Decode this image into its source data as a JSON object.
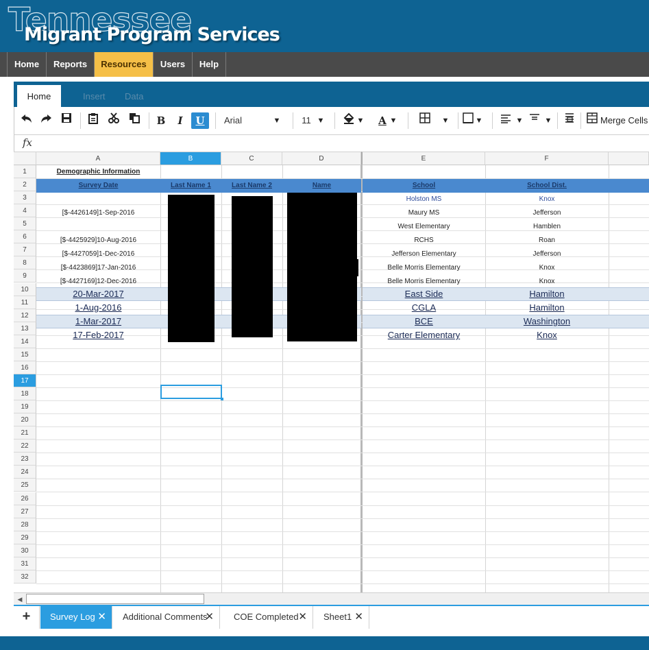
{
  "brand": {
    "state": "Tennessee",
    "title": "Migrant Program Services"
  },
  "nav": {
    "items": [
      {
        "label": "Home"
      },
      {
        "label": "Reports"
      },
      {
        "label": "Resources"
      },
      {
        "label": "Users"
      },
      {
        "label": "Help"
      }
    ],
    "active": "Resources"
  },
  "ribbon": {
    "tabs": [
      {
        "label": "Home"
      },
      {
        "label": "Insert"
      },
      {
        "label": "Data"
      }
    ],
    "active": "Home"
  },
  "toolbar": {
    "bold": "B",
    "italic": "I",
    "underline": "U",
    "font_name": "Arial",
    "font_size": "11",
    "font_color_letter": "A",
    "merge_cells": "Merge Cells"
  },
  "formula_bar": {
    "fx": "fx",
    "value": ""
  },
  "grid": {
    "columns": [
      "A",
      "B",
      "C",
      "D",
      "E",
      "F"
    ],
    "selected_column": "B",
    "selected_row": 17,
    "rows": [
      "1",
      "2",
      "3",
      "4",
      "5",
      "6",
      "7",
      "8",
      "9",
      "10",
      "11",
      "12",
      "13",
      "14",
      "15",
      "16",
      "17",
      "18",
      "19",
      "20",
      "21",
      "22",
      "23",
      "24",
      "25",
      "26",
      "27",
      "28",
      "29",
      "30",
      "31",
      "32"
    ],
    "title_cell": "Demographic Information",
    "headers": {
      "survey_date": "Survey Date",
      "last_name_1": "Last Name 1",
      "last_name_2": "Last Name 2",
      "name": "Name",
      "school": "School",
      "school_dist": "School Dist."
    },
    "data_rows": [
      {
        "date": "",
        "school": "Holston MS",
        "dist": "Knox"
      },
      {
        "date": "[$-4426149]1-Sep-2016",
        "school": "Maury MS",
        "dist": "Jefferson"
      },
      {
        "date": "",
        "school": "West Elementary",
        "dist": "Hamblen"
      },
      {
        "date": "[$-4425929]10-Aug-2016",
        "school": "RCHS",
        "dist": "Roan"
      },
      {
        "date": "[$-4427059]1-Dec-2016",
        "school": "Jefferson Elementary",
        "dist": "Jefferson"
      },
      {
        "date": "[$-4423869]17-Jan-2016",
        "school": "Belle Morris Elementary",
        "dist": "Knox"
      },
      {
        "date": "[$-4427169]12-Dec-2016",
        "school": "Belle Morris Elementary",
        "dist": "Knox"
      },
      {
        "date": "20-Mar-2017",
        "school": "East Side",
        "dist": "Hamilton"
      },
      {
        "date": "1-Aug-2016",
        "school": "CGLA",
        "dist": "Hamilton"
      },
      {
        "date": "1-Mar-2017",
        "school": "BCE",
        "dist": "Washington"
      },
      {
        "date": "17-Feb-2017",
        "school": "Carter Elementary",
        "dist": "Knox"
      }
    ]
  },
  "sheet_tabs": {
    "add": "+",
    "tabs": [
      {
        "label": "Survey Log"
      },
      {
        "label": "Additional Comments"
      },
      {
        "label": "COE Completed"
      },
      {
        "label": "Sheet1"
      }
    ],
    "active": "Survey Log",
    "close": "✕"
  },
  "colors": {
    "brand_blue": "#0e6393",
    "nav_dark": "#4a4a4a",
    "nav_active": "#f5bf47",
    "accent": "#2b9de0",
    "header_row": "#4a89cf",
    "band_row": "#dce6f1"
  }
}
